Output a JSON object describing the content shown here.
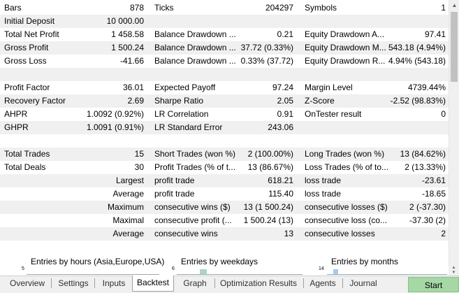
{
  "rows": [
    [
      "Bars",
      "878",
      "Ticks",
      "204297",
      "Symbols",
      "1"
    ],
    [
      "Initial Deposit",
      "10 000.00",
      "",
      "",
      "",
      ""
    ],
    [
      "Total Net Profit",
      "1 458.58",
      "Balance Drawdown ...",
      "0.21",
      "Equity Drawdown A...",
      "97.41"
    ],
    [
      "Gross Profit",
      "1 500.24",
      "Balance Drawdown ...",
      "37.72 (0.33%)",
      "Equity Drawdown M...",
      "543.18 (4.94%)"
    ],
    [
      "Gross Loss",
      "-41.66",
      "Balance Drawdown ...",
      "0.33% (37.72)",
      "Equity Drawdown R...",
      "4.94% (543.18)"
    ],
    [
      "",
      "",
      "",
      "",
      "",
      ""
    ],
    [
      "Profit Factor",
      "36.01",
      "Expected Payoff",
      "97.24",
      "Margin Level",
      "4739.44%"
    ],
    [
      "Recovery Factor",
      "2.69",
      "Sharpe Ratio",
      "2.05",
      "Z-Score",
      "-2.52 (98.83%)"
    ],
    [
      "AHPR",
      "1.0092 (0.92%)",
      "LR Correlation",
      "0.91",
      "OnTester result",
      "0"
    ],
    [
      "GHPR",
      "1.0091 (0.91%)",
      "LR Standard Error",
      "243.06",
      "",
      ""
    ],
    [
      "",
      "",
      "",
      "",
      "",
      ""
    ],
    [
      "Total Trades",
      "15",
      "Short Trades (won %)",
      "2 (100.00%)",
      "Long Trades (won %)",
      "13 (84.62%)"
    ],
    [
      "Total Deals",
      "30",
      "Profit Trades (% of t...",
      "13 (86.67%)",
      "Loss Trades (% of to...",
      "2 (13.33%)"
    ],
    [
      "",
      "Largest",
      "profit trade",
      "618.21",
      "loss trade",
      "-23.61"
    ],
    [
      "",
      "Average",
      "profit trade",
      "115.40",
      "loss trade",
      "-18.65"
    ],
    [
      "",
      "Maximum",
      "consecutive wins ($)",
      "13 (1 500.24)",
      "consecutive losses ($)",
      "2 (-37.30)"
    ],
    [
      "",
      "Maximal",
      "consecutive profit (...",
      "1 500.24 (13)",
      "consecutive loss (co...",
      "-37.30 (2)"
    ],
    [
      "",
      "Average",
      "consecutive wins",
      "13",
      "consecutive losses",
      "2"
    ]
  ],
  "charts": [
    {
      "title": "Entries by hours (Asia,Europe,USA)",
      "axis_max": "5"
    },
    {
      "title": "Entries by weekdays",
      "axis_max": "6"
    },
    {
      "title": "Entries by months",
      "axis_max": "14"
    }
  ],
  "tabs": [
    "Overview",
    "Settings",
    "Inputs",
    "Backtest",
    "Graph",
    "Optimization Results",
    "Agents",
    "Journal"
  ],
  "active_tab": "Backtest",
  "start_button": "Start",
  "colors": {
    "start_button": "#a6d8a6",
    "chart_bar": "#a8d8c0",
    "chart_bar_blue": "#a8cce8"
  }
}
